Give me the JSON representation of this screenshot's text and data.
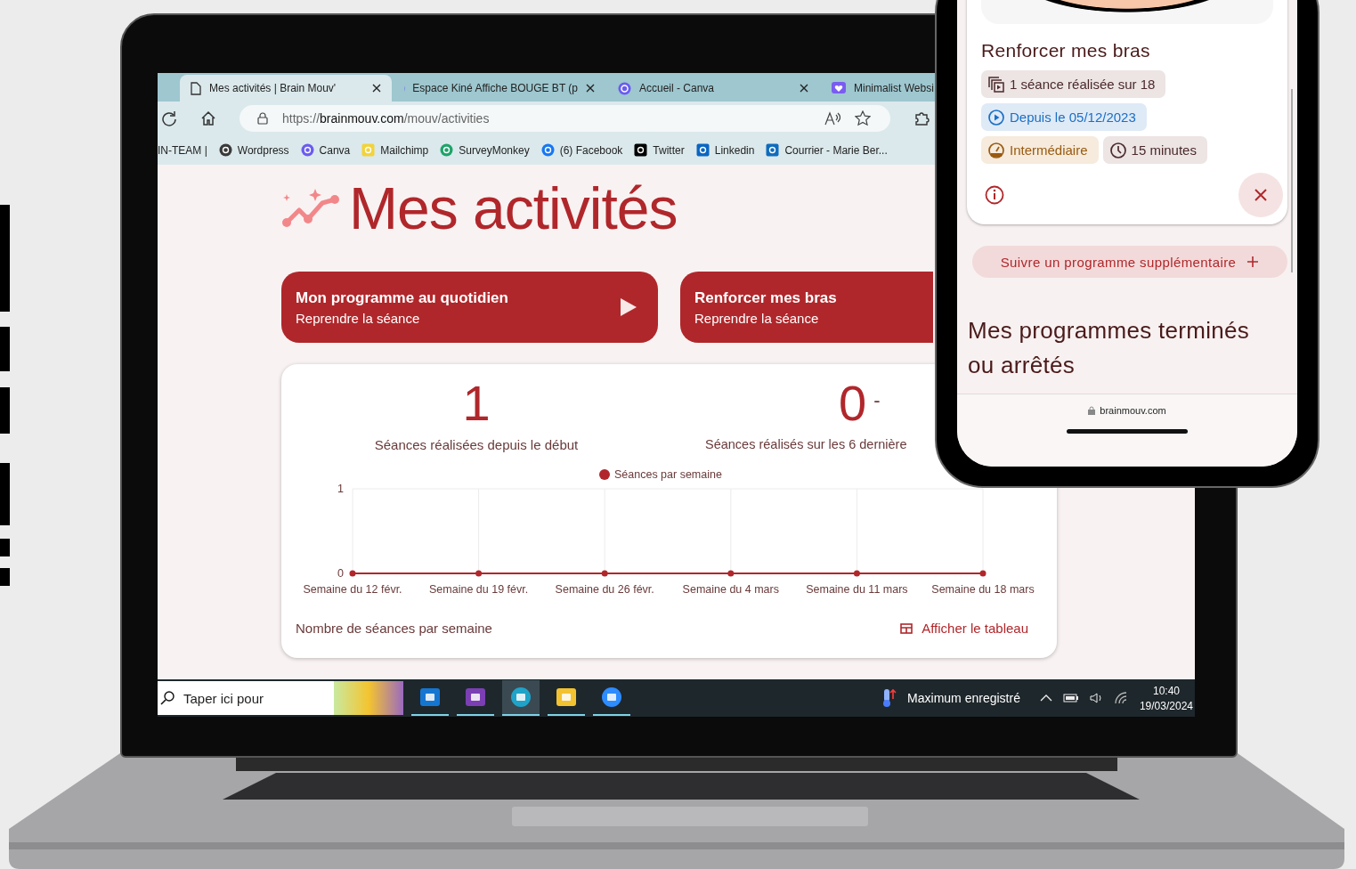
{
  "browser": {
    "tabs": [
      {
        "label": "Mes activités | Brain Mouv'",
        "selected": true,
        "kind": "page"
      },
      {
        "label": "Espace Kiné Affiche BOUGE BT (p",
        "selected": false,
        "kind": "canva"
      },
      {
        "label": "Accueil - Canva",
        "selected": false,
        "kind": "canva"
      },
      {
        "label": "Minimalist Websi",
        "selected": false,
        "kind": "heart"
      }
    ],
    "url": {
      "scheme": "https://",
      "domain": "brainmouv.com",
      "path": "/mouv/activities"
    },
    "bookmarks": [
      {
        "label": "IN-TEAM |",
        "kind": "none"
      },
      {
        "label": "Wordpress",
        "kind": "wordpress"
      },
      {
        "label": "Canva",
        "kind": "canva"
      },
      {
        "label": "Mailchimp",
        "kind": "mailchimp"
      },
      {
        "label": "SurveyMonkey",
        "kind": "surveymonkey"
      },
      {
        "label": "(6) Facebook",
        "kind": "facebook"
      },
      {
        "label": "Twitter",
        "kind": "x"
      },
      {
        "label": "Linkedin",
        "kind": "linkedin"
      },
      {
        "label": "Courrier - Marie Ber...",
        "kind": "outlook"
      }
    ]
  },
  "page": {
    "title": "Mes activités",
    "programs": [
      {
        "title": "Mon programme au quotidien",
        "subtitle": "Reprendre la séance"
      },
      {
        "title": "Renforcer mes bras",
        "subtitle": "Reprendre la séance"
      }
    ],
    "stats": [
      {
        "value": "1",
        "label": "Séances réalisées depuis le début"
      },
      {
        "value": "0",
        "suffix": "-",
        "label": "Séances réalisés sur les 6 dernière"
      }
    ],
    "chart_data": {
      "type": "line",
      "categories": [
        "Semaine du 12 févr.",
        "Semaine du 19 févr.",
        "Semaine du 26 févr.",
        "Semaine du 4 mars",
        "Semaine du 11 mars",
        "Semaine du 18 mars"
      ],
      "series": [
        {
          "name": "Séances par semaine",
          "color": "#b0272b",
          "values": [
            0,
            0,
            0,
            0,
            0,
            0
          ]
        }
      ],
      "ylim": [
        0,
        1
      ],
      "yticks": [
        0,
        1
      ],
      "grid": true,
      "marker": true
    },
    "caption": "Nombre de séances par semaine",
    "table_link": "Afficher le tableau"
  },
  "taskbar": {
    "search_placeholder": "Taper ici pour",
    "apps": [
      {
        "kind": "outlook",
        "selected": false
      },
      {
        "kind": "onenote",
        "selected": false
      },
      {
        "kind": "edge",
        "selected": true
      },
      {
        "kind": "explorer",
        "selected": false
      },
      {
        "kind": "zoom",
        "selected": false
      }
    ],
    "weather": "Maximum enregistré",
    "time": "10:40",
    "date": "19/03/2024"
  },
  "phone": {
    "program_title": "Renforcer mes bras",
    "chips": [
      {
        "kind": "sessions",
        "text": "1 séance réalisée sur 18"
      },
      {
        "kind": "start",
        "text": "Depuis le 05/12/2023"
      },
      {
        "kind": "level",
        "text": "Intermédiaire"
      },
      {
        "kind": "duration",
        "text": "15 minutes"
      }
    ],
    "add_button": "Suivre un programme supplémentaire",
    "section_title": "Mes programmes terminés ou arrêtés",
    "url": "brainmouv.com"
  }
}
